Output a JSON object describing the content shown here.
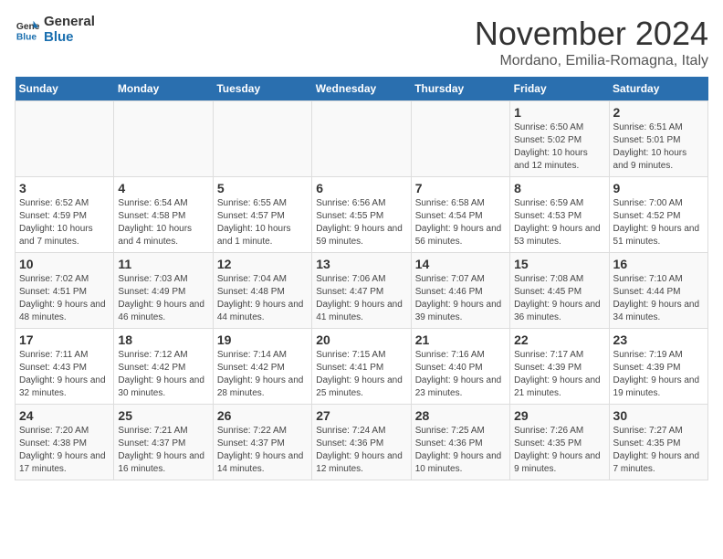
{
  "logo": {
    "general": "General",
    "blue": "Blue"
  },
  "title": "November 2024",
  "subtitle": "Mordano, Emilia-Romagna, Italy",
  "days_of_week": [
    "Sunday",
    "Monday",
    "Tuesday",
    "Wednesday",
    "Thursday",
    "Friday",
    "Saturday"
  ],
  "weeks": [
    [
      {
        "day": "",
        "info": ""
      },
      {
        "day": "",
        "info": ""
      },
      {
        "day": "",
        "info": ""
      },
      {
        "day": "",
        "info": ""
      },
      {
        "day": "",
        "info": ""
      },
      {
        "day": "1",
        "info": "Sunrise: 6:50 AM\nSunset: 5:02 PM\nDaylight: 10 hours and 12 minutes."
      },
      {
        "day": "2",
        "info": "Sunrise: 6:51 AM\nSunset: 5:01 PM\nDaylight: 10 hours and 9 minutes."
      }
    ],
    [
      {
        "day": "3",
        "info": "Sunrise: 6:52 AM\nSunset: 4:59 PM\nDaylight: 10 hours and 7 minutes."
      },
      {
        "day": "4",
        "info": "Sunrise: 6:54 AM\nSunset: 4:58 PM\nDaylight: 10 hours and 4 minutes."
      },
      {
        "day": "5",
        "info": "Sunrise: 6:55 AM\nSunset: 4:57 PM\nDaylight: 10 hours and 1 minute."
      },
      {
        "day": "6",
        "info": "Sunrise: 6:56 AM\nSunset: 4:55 PM\nDaylight: 9 hours and 59 minutes."
      },
      {
        "day": "7",
        "info": "Sunrise: 6:58 AM\nSunset: 4:54 PM\nDaylight: 9 hours and 56 minutes."
      },
      {
        "day": "8",
        "info": "Sunrise: 6:59 AM\nSunset: 4:53 PM\nDaylight: 9 hours and 53 minutes."
      },
      {
        "day": "9",
        "info": "Sunrise: 7:00 AM\nSunset: 4:52 PM\nDaylight: 9 hours and 51 minutes."
      }
    ],
    [
      {
        "day": "10",
        "info": "Sunrise: 7:02 AM\nSunset: 4:51 PM\nDaylight: 9 hours and 48 minutes."
      },
      {
        "day": "11",
        "info": "Sunrise: 7:03 AM\nSunset: 4:49 PM\nDaylight: 9 hours and 46 minutes."
      },
      {
        "day": "12",
        "info": "Sunrise: 7:04 AM\nSunset: 4:48 PM\nDaylight: 9 hours and 44 minutes."
      },
      {
        "day": "13",
        "info": "Sunrise: 7:06 AM\nSunset: 4:47 PM\nDaylight: 9 hours and 41 minutes."
      },
      {
        "day": "14",
        "info": "Sunrise: 7:07 AM\nSunset: 4:46 PM\nDaylight: 9 hours and 39 minutes."
      },
      {
        "day": "15",
        "info": "Sunrise: 7:08 AM\nSunset: 4:45 PM\nDaylight: 9 hours and 36 minutes."
      },
      {
        "day": "16",
        "info": "Sunrise: 7:10 AM\nSunset: 4:44 PM\nDaylight: 9 hours and 34 minutes."
      }
    ],
    [
      {
        "day": "17",
        "info": "Sunrise: 7:11 AM\nSunset: 4:43 PM\nDaylight: 9 hours and 32 minutes."
      },
      {
        "day": "18",
        "info": "Sunrise: 7:12 AM\nSunset: 4:42 PM\nDaylight: 9 hours and 30 minutes."
      },
      {
        "day": "19",
        "info": "Sunrise: 7:14 AM\nSunset: 4:42 PM\nDaylight: 9 hours and 28 minutes."
      },
      {
        "day": "20",
        "info": "Sunrise: 7:15 AM\nSunset: 4:41 PM\nDaylight: 9 hours and 25 minutes."
      },
      {
        "day": "21",
        "info": "Sunrise: 7:16 AM\nSunset: 4:40 PM\nDaylight: 9 hours and 23 minutes."
      },
      {
        "day": "22",
        "info": "Sunrise: 7:17 AM\nSunset: 4:39 PM\nDaylight: 9 hours and 21 minutes."
      },
      {
        "day": "23",
        "info": "Sunrise: 7:19 AM\nSunset: 4:39 PM\nDaylight: 9 hours and 19 minutes."
      }
    ],
    [
      {
        "day": "24",
        "info": "Sunrise: 7:20 AM\nSunset: 4:38 PM\nDaylight: 9 hours and 17 minutes."
      },
      {
        "day": "25",
        "info": "Sunrise: 7:21 AM\nSunset: 4:37 PM\nDaylight: 9 hours and 16 minutes."
      },
      {
        "day": "26",
        "info": "Sunrise: 7:22 AM\nSunset: 4:37 PM\nDaylight: 9 hours and 14 minutes."
      },
      {
        "day": "27",
        "info": "Sunrise: 7:24 AM\nSunset: 4:36 PM\nDaylight: 9 hours and 12 minutes."
      },
      {
        "day": "28",
        "info": "Sunrise: 7:25 AM\nSunset: 4:36 PM\nDaylight: 9 hours and 10 minutes."
      },
      {
        "day": "29",
        "info": "Sunrise: 7:26 AM\nSunset: 4:35 PM\nDaylight: 9 hours and 9 minutes."
      },
      {
        "day": "30",
        "info": "Sunrise: 7:27 AM\nSunset: 4:35 PM\nDaylight: 9 hours and 7 minutes."
      }
    ]
  ]
}
